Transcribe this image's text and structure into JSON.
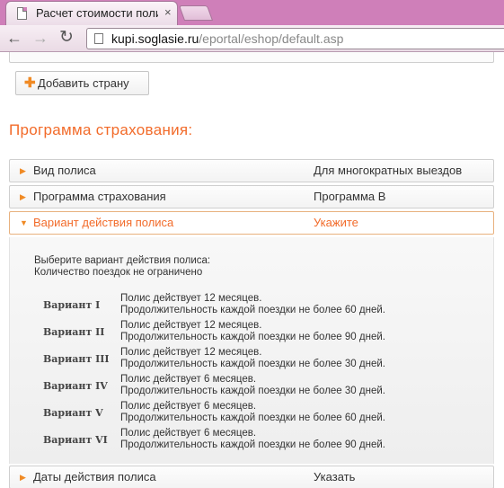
{
  "browser": {
    "tab_title": "Расчет стоимости полис",
    "tab_close": "×",
    "url_host": "kupi.soglasie.ru",
    "url_path": "/eportal/eshop/default.asp",
    "icons": [
      "document-icon",
      "close-icon",
      "back-icon",
      "forward-icon",
      "reload-icon",
      "page-icon"
    ]
  },
  "page": {
    "add_country_label": "Добавить страну",
    "add_country_icon": "plus-icon",
    "section_title": "Программа страхования:",
    "accent_color": "#f26b2a",
    "rows": [
      {
        "label": "Вид полиса",
        "value": "Для многократных выездов"
      },
      {
        "label": "Программа страхования",
        "value": "Программа В"
      },
      {
        "label": "Вариант действия полиса",
        "value": "Укажите"
      },
      {
        "label": "Даты действия полиса",
        "value": "Указать"
      }
    ],
    "panel": {
      "intro_1": "Выберите вариант действия полиса:",
      "intro_2": "Количество поездок не ограничено",
      "variants": [
        {
          "name": "Вариант I",
          "line1": "Полис действует 12 месяцев.",
          "line2": "Продолжительность каждой поездки не более 60 дней."
        },
        {
          "name": "Вариант II",
          "line1": "Полис действует 12 месяцев.",
          "line2": "Продолжительность каждой поездки не более 90 дней."
        },
        {
          "name": "Вариант III",
          "line1": "Полис действует 12 месяцев.",
          "line2": "Продолжительность каждой поездки не более 30 дней."
        },
        {
          "name": "Вариант IV",
          "line1": "Полис действует 6 месяцев.",
          "line2": "Продолжительность каждой поездки не более 30 дней."
        },
        {
          "name": "Вариант V",
          "line1": "Полис действует 6 месяцев.",
          "line2": "Продолжительность каждой поездки не более 60 дней."
        },
        {
          "name": "Вариант VI",
          "line1": "Полис действует 6 месяцев.",
          "line2": "Продолжительность каждой поездки не более 90 дней."
        }
      ]
    }
  }
}
